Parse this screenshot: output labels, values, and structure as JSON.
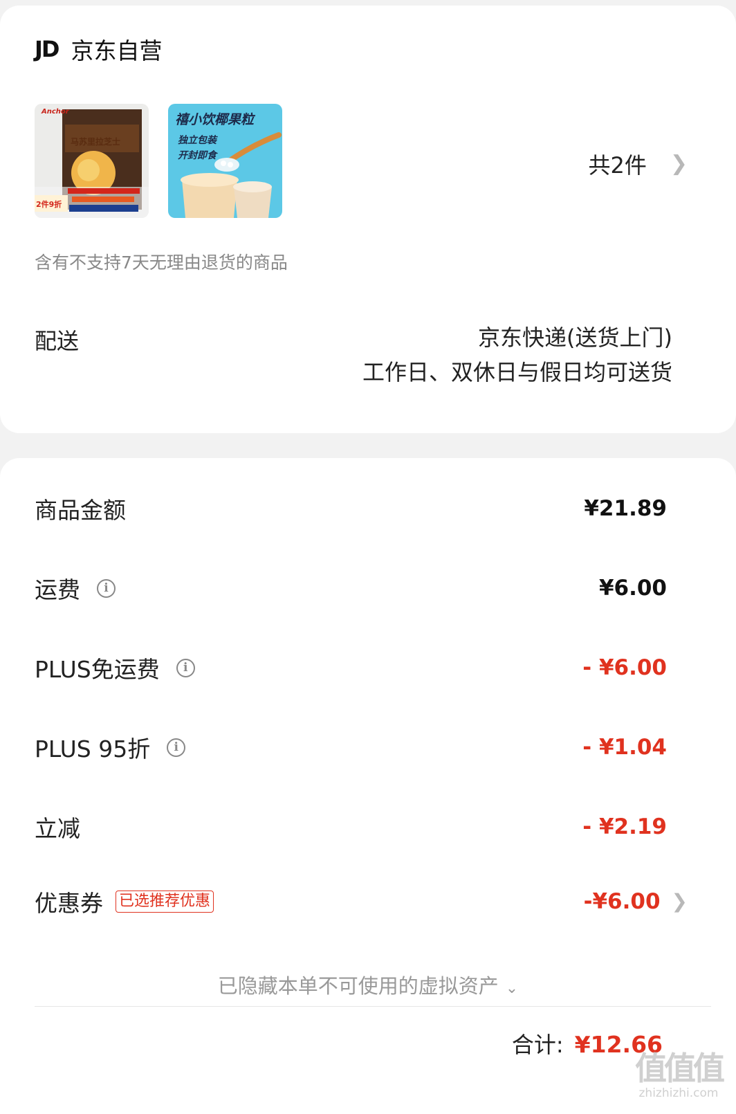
{
  "store": {
    "logo": "JD",
    "name": "京东自营"
  },
  "products": {
    "item1": {
      "brand": "Anchor",
      "name": "马苏里拉芝士",
      "badge": "2件9折"
    },
    "item2": {
      "title": "禧小饮椰果粒",
      "line1": "独立包装",
      "line2": "开封即食"
    },
    "count_label": "共2件"
  },
  "notice": "含有不支持7天无理由退货的商品",
  "delivery": {
    "label": "配送",
    "method": "京东快递(送货上门)",
    "schedule": "工作日、双休日与假日均可送货"
  },
  "summary": {
    "rows": [
      {
        "label": "商品金额",
        "value": "¥21.89"
      },
      {
        "label": "运费",
        "value": "¥6.00"
      },
      {
        "label": "PLUS免运费",
        "value": "- ¥6.00"
      },
      {
        "label": "PLUS 95折",
        "value": "- ¥1.04"
      },
      {
        "label": "立减",
        "value": "- ¥2.19"
      },
      {
        "label": "优惠券",
        "value": "-¥6.00",
        "tag": "已选推荐优惠"
      }
    ],
    "hidden_assets": "已隐藏本单不可使用的虚拟资产",
    "total_label": "合计:",
    "total_value": "¥12.66"
  },
  "watermark": {
    "big": "值值值",
    "small": "zhizhizhi.com"
  },
  "colors": {
    "accent_red": "#e0321f",
    "muted_gray": "#888888",
    "background": "#f2f2f2"
  },
  "icons": [
    "jd-logo",
    "chevron-right-icon",
    "info-icon",
    "chevron-down-icon"
  ]
}
